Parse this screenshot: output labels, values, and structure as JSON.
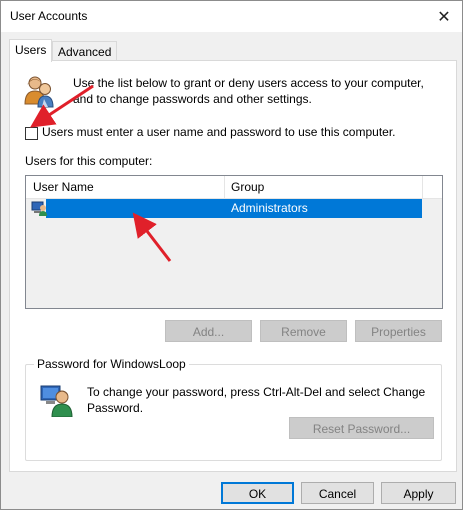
{
  "window": {
    "title": "User Accounts",
    "close_glyph": "✕"
  },
  "tabs": [
    {
      "label": "Users",
      "active": true
    },
    {
      "label": "Advanced",
      "active": false
    }
  ],
  "intro": {
    "icon": "users-group-icon",
    "text_line1": "Use the list below to grant or deny users access to your computer,",
    "text_line2": "and to change passwords and other settings."
  },
  "login_checkbox": {
    "label": "Users must enter a user name and password to use this computer.",
    "checked": false
  },
  "users_list": {
    "caption": "Users for this computer:",
    "columns": [
      "User Name",
      "Group"
    ],
    "rows": [
      {
        "user_name": "",
        "group": "Administrators",
        "selected": true,
        "icon": "user-computer-icon"
      }
    ]
  },
  "list_buttons": {
    "add": "Add...",
    "remove": "Remove",
    "properties": "Properties"
  },
  "password_group": {
    "legend": "Password for WindowsLoop",
    "icon": "user-password-icon",
    "text_line1": "To change your password, press Ctrl-Alt-Del and select Change",
    "text_line2": "Password.",
    "reset_button": "Reset Password..."
  },
  "dialog_buttons": {
    "ok": "OK",
    "cancel": "Cancel",
    "apply": "Apply"
  },
  "colors": {
    "selection": "#0078d7",
    "annotation_arrow": "#e0202a"
  }
}
